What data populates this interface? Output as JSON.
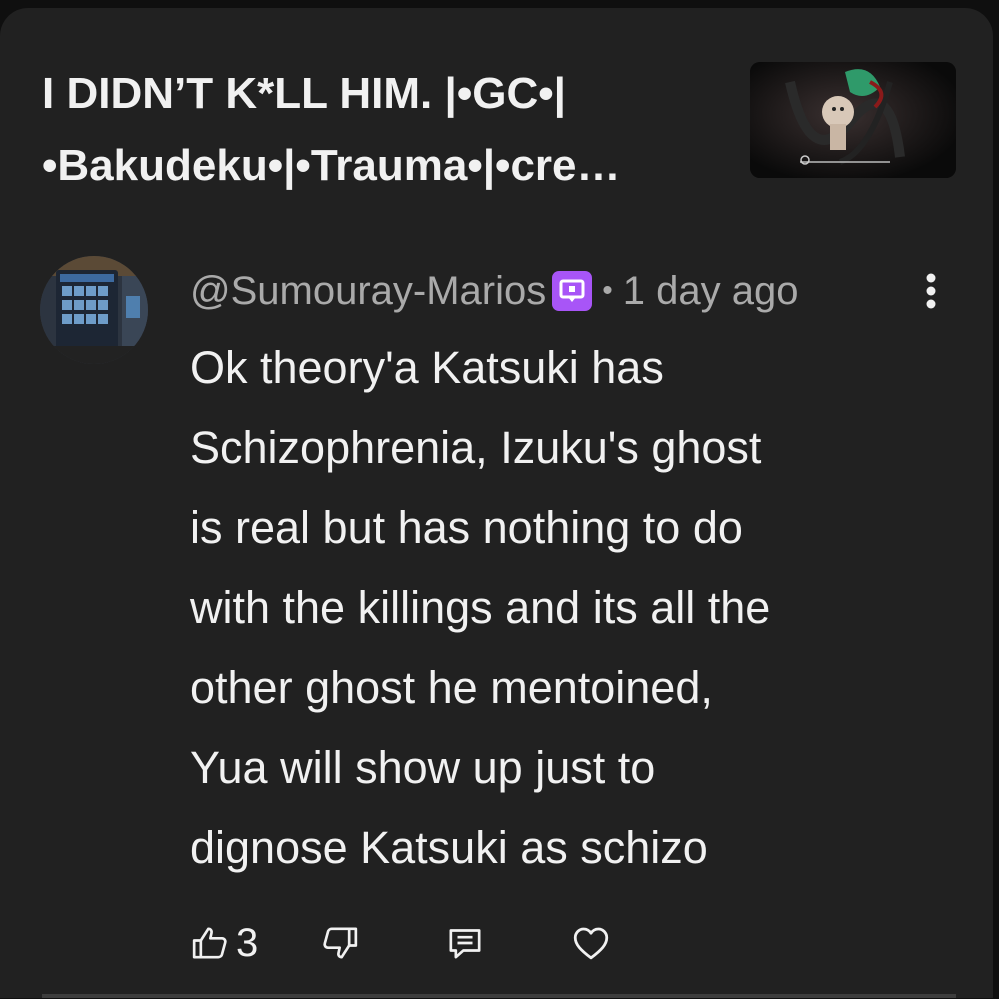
{
  "video": {
    "title_line1": "I DIDN’T K*LL HIM. |•GC•|",
    "title_line2": "•Bakudeku•|•Trauma•|•cre…",
    "thumbnail_icon": "video-thumbnail"
  },
  "comment": {
    "author": "@Sumouray-Marios",
    "separator": "•",
    "time": "1 day ago",
    "lines": [
      "Ok theory'a Katsuki has",
      "Schizophrenia, Izuku's ghost",
      "is real but has nothing to do",
      "with the killings and its all the",
      "other ghost he mentoined,",
      "Yua will show up just to",
      "dignose Katsuki as schizo"
    ],
    "likes": "3"
  },
  "colors": {
    "background": "#212121",
    "text": "#f1f1f1",
    "secondary_text": "#aaaaaa",
    "badge": "#a855f7"
  },
  "icons": {
    "more": "more-vert-icon",
    "like": "thumb-up-icon",
    "dislike": "thumb-down-icon",
    "reply": "comment-icon",
    "heart": "heart-icon",
    "badge": "member-badge-icon"
  }
}
